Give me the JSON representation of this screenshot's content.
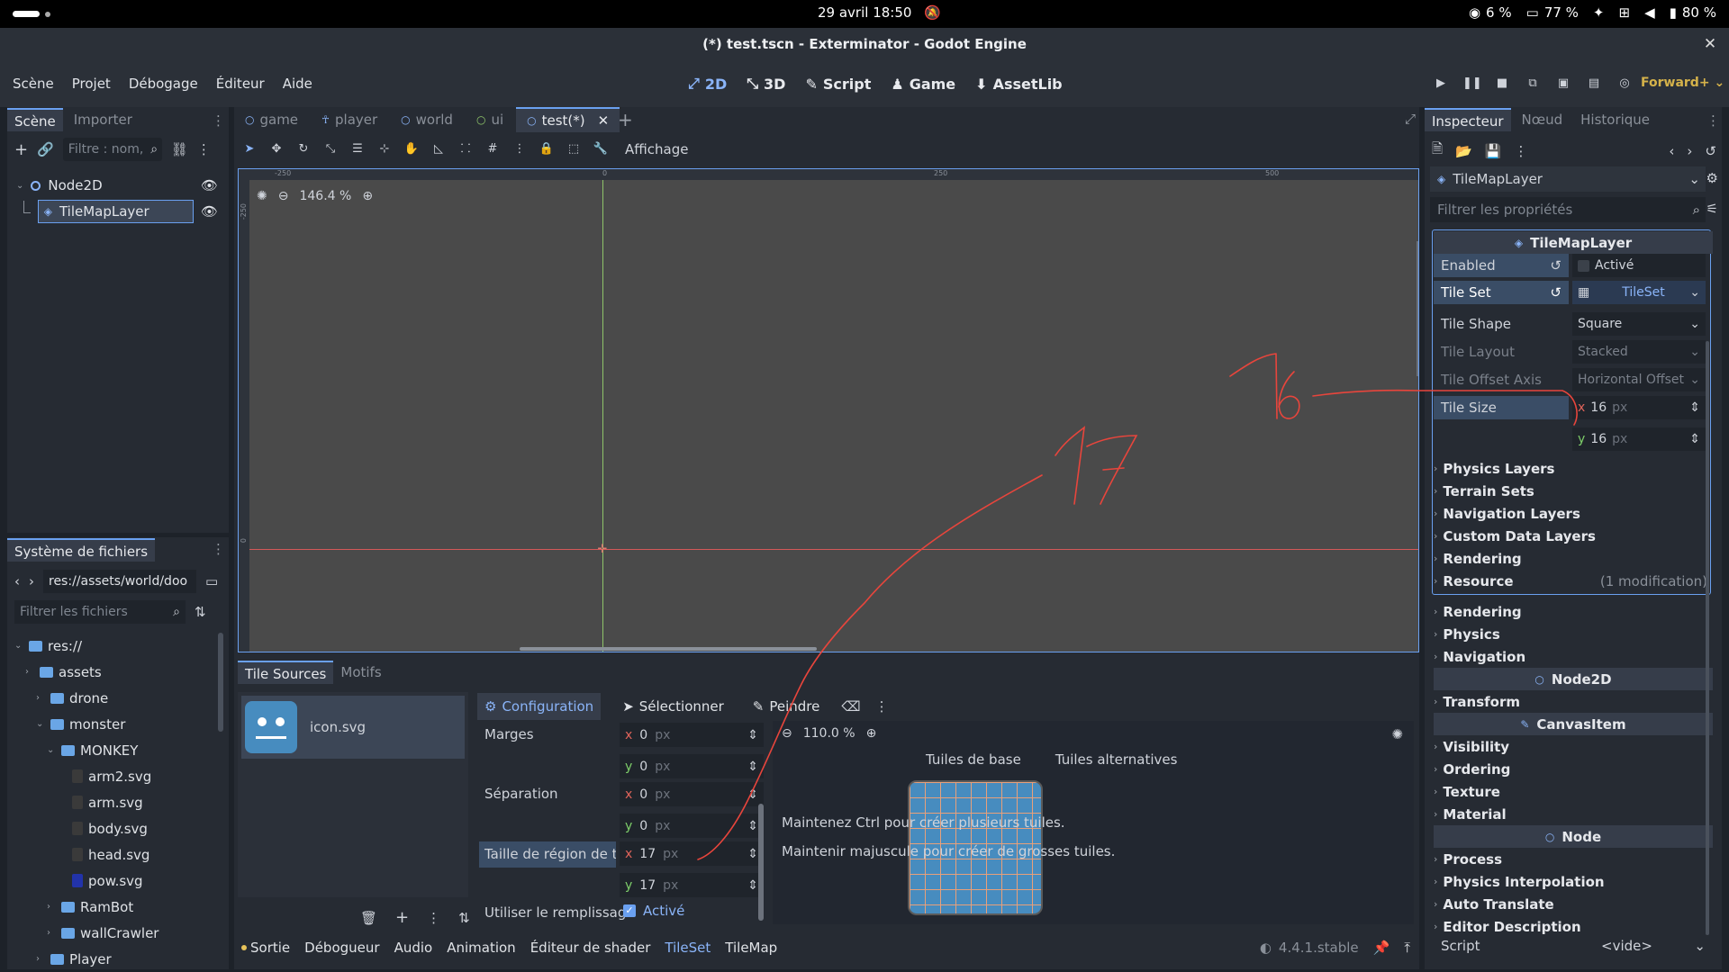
{
  "os": {
    "clock": "29 avril  18:50",
    "cpu": "6 %",
    "mem": "77 %",
    "battery": "80 %"
  },
  "window": {
    "title": "(*) test.tscn - Exterminator - Godot Engine"
  },
  "menu": {
    "items": [
      "Scène",
      "Projet",
      "Débogage",
      "Éditeur",
      "Aide"
    ],
    "modes": [
      "2D",
      "3D",
      "Script",
      "Game",
      "AssetLib"
    ],
    "renderer": "Forward+"
  },
  "scene_dock": {
    "tabs": [
      "Scène",
      "Importer"
    ],
    "filter_placeholder": "Filtre : nom,",
    "nodes": [
      {
        "name": "Node2D"
      },
      {
        "name": "TileMapLayer"
      }
    ]
  },
  "fs_dock": {
    "title": "Système de fichiers",
    "path": "res://assets/world/doo",
    "filter_placeholder": "Filtrer les fichiers",
    "tree": [
      {
        "label": "res://",
        "depth": 0,
        "type": "folder"
      },
      {
        "label": "assets",
        "depth": 1,
        "type": "folder"
      },
      {
        "label": "drone",
        "depth": 2,
        "type": "folder"
      },
      {
        "label": "monster",
        "depth": 2,
        "type": "folder"
      },
      {
        "label": "MONKEY",
        "depth": 3,
        "type": "folder"
      },
      {
        "label": "arm2.svg",
        "depth": 4,
        "type": "file"
      },
      {
        "label": "arm.svg",
        "depth": 4,
        "type": "file"
      },
      {
        "label": "body.svg",
        "depth": 4,
        "type": "file"
      },
      {
        "label": "head.svg",
        "depth": 4,
        "type": "file"
      },
      {
        "label": "pow.svg",
        "depth": 4,
        "type": "file"
      },
      {
        "label": "RamBot",
        "depth": 3,
        "type": "folder"
      },
      {
        "label": "wallCrawler",
        "depth": 3,
        "type": "folder"
      },
      {
        "label": "Player",
        "depth": 2,
        "type": "folder"
      }
    ]
  },
  "scene_tabs": [
    "game",
    "player",
    "world",
    "ui",
    "test(*)"
  ],
  "viewport": {
    "zoom": "146.4 %",
    "display_label": "Affichage",
    "ruler_ticks": [
      "-250",
      "0",
      "250",
      "500"
    ],
    "vruler_ticks": [
      "-250",
      "0"
    ]
  },
  "tile_editor": {
    "tabs": [
      "Tile Sources",
      "Motifs"
    ],
    "source_name": "icon.svg",
    "modes": [
      "Configuration",
      "Sélectionner",
      "Peindre"
    ],
    "props": {
      "margins_label": "Marges",
      "sep_label": "Séparation",
      "region_label": "Taille de région de te",
      "fill_label": "Utiliser le remplissag",
      "margin_x": "0",
      "margin_y": "0",
      "sep_x": "0",
      "sep_y": "0",
      "region_x": "17",
      "region_y": "17",
      "unit": "px",
      "fill_value": "Activé"
    },
    "atlas_zoom": "110.0 %",
    "atlas_tabs": [
      "Tuiles de base",
      "Tuiles alternatives"
    ],
    "hint1": "Maintenez Ctrl pour créer plusieurs tuiles.",
    "hint2": "Maintenir majuscule pour créer de grosses tuiles."
  },
  "status": {
    "items": [
      "Sortie",
      "Débogueur",
      "Audio",
      "Animation",
      "Éditeur de shader",
      "TileSet",
      "TileMap"
    ],
    "version": "4.4.1.stable"
  },
  "inspector": {
    "tabs": [
      "Inspecteur",
      "Nœud",
      "Historique"
    ],
    "node": "TileMapLayer",
    "filter_placeholder": "Filtrer les propriétés",
    "section": "TileMapLayer",
    "enabled_label": "Enabled",
    "enabled_value": "Activé",
    "tileset_label": "Tile Set",
    "tileset_value": "TileSet",
    "shape_label": "Tile Shape",
    "shape_value": "Square",
    "layout_label": "Tile Layout",
    "layout_value": "Stacked",
    "offset_label": "Tile Offset Axis",
    "offset_value": "Horizontal Offset",
    "size_label": "Tile Size",
    "size_x": "16",
    "size_y": "16",
    "unit": "px",
    "sub_sections": [
      "Physics Layers",
      "Terrain Sets",
      "Navigation Layers",
      "Custom Data Layers",
      "Rendering",
      "Resource"
    ],
    "resource_note": "(1 modification)",
    "layer_sections": [
      "Rendering",
      "Physics",
      "Navigation"
    ],
    "cat_node2d": "Node2D",
    "node2d_sections": [
      "Transform"
    ],
    "cat_canvas": "CanvasItem",
    "canvas_sections": [
      "Visibility",
      "Ordering",
      "Texture",
      "Material"
    ],
    "cat_node": "Node",
    "node_sections": [
      "Process",
      "Physics Interpolation",
      "Auto Translate",
      "Editor Description"
    ],
    "script_label": "Script",
    "script_value": "<vide>"
  },
  "annotations": {
    "a1": "16",
    "a2": "17"
  }
}
